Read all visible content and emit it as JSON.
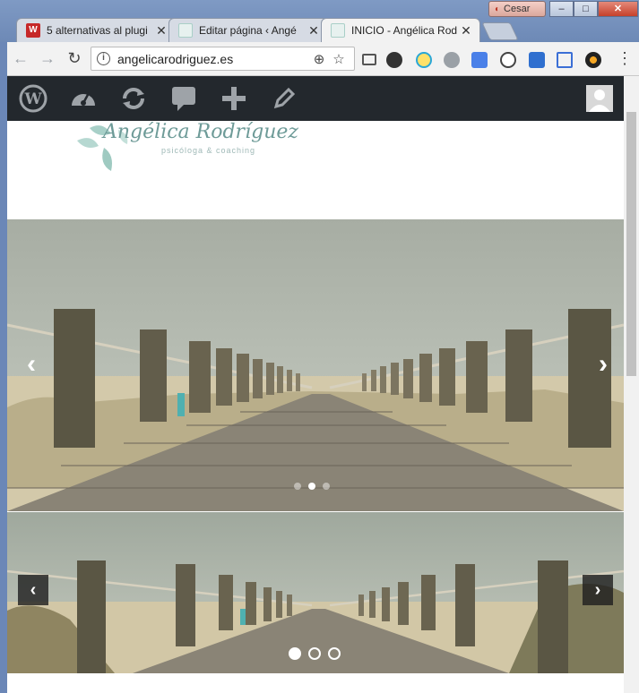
{
  "window": {
    "user_name": "Cesar",
    "minimize_label": "–",
    "maximize_label": "□",
    "close_label": "✕"
  },
  "tabs": [
    {
      "title": "5 alternativas al plugi",
      "icon": "wordfence-icon",
      "active": false
    },
    {
      "title": "Editar página ‹ Angé",
      "icon": "site-leaf-icon",
      "active": false
    },
    {
      "title": "INICIO - Angélica Rod",
      "icon": "site-leaf-icon",
      "active": true
    }
  ],
  "toolbar": {
    "url": "angelicarodriguez.es",
    "back_label": "←",
    "forward_label": "→",
    "reload_label": "↻",
    "zoom_label": "⊕",
    "star_label": "☆",
    "menu_label": "⋮"
  },
  "admin_bar": {
    "items": [
      "wordpress-logo-icon",
      "dashboard-icon",
      "updates-icon",
      "comments-icon",
      "new-content-icon",
      "edit-page-icon",
      "user-avatar"
    ]
  },
  "site": {
    "logo_title": "Angélica Rodríguez",
    "logo_subtitle": "psicóloga & coaching"
  },
  "slider_top": {
    "prev_label": "‹",
    "next_label": "›",
    "slides": 3,
    "active_slide": 2
  },
  "slider_bottom": {
    "prev_label": "‹",
    "next_label": "›",
    "slides": 3,
    "active_slide": 1
  },
  "colors": {
    "admin_bar": "#23282d",
    "logo_teal": "#6e9b98",
    "chrome_frame": "#6b87b7"
  }
}
